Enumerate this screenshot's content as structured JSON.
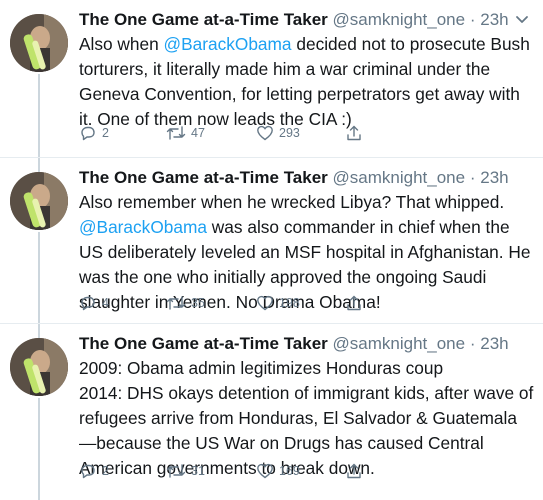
{
  "tweets": [
    {
      "author": "The One Game at-a-Time Taker",
      "handle": "@samknight_one",
      "dot": "·",
      "time": "23h",
      "text_before": "Also when ",
      "mention": "@BarackObama",
      "text_after": " decided not to prosecute Bush torturers, it literally made him a war criminal under the Geneva Convention, for letting perpetrators get away with it. One of them now leads the CIA :)",
      "replies": "2",
      "retweets": "47",
      "likes": "293"
    },
    {
      "author": "The One Game at-a-Time Taker",
      "handle": "@samknight_one",
      "dot": "·",
      "time": "23h",
      "text_before": "Also remember when he wrecked Libya? That whipped.\n",
      "mention": "@BarackObama",
      "text_after": " was also commander in chief when the US deliberately leveled an MSF hospital in Afghanistan. He was the one who initially approved the ongoing Saudi slaughter in Yemen. No Drama Obama!",
      "replies": "4",
      "retweets": "35",
      "likes": "198"
    },
    {
      "author": "The One Game at-a-Time Taker",
      "handle": "@samknight_one",
      "dot": "·",
      "time": "23h",
      "text_before": "2009: Obama admin legitimizes Honduras coup\n2014: DHS okays detention of immigrant kids, after wave of refugees arrive from Honduras, El Salvador & Guatemala—because the US War on Drugs has caused Central American governments to break down.",
      "mention": "",
      "text_after": "",
      "replies": "2",
      "retweets": "31",
      "likes": "169"
    }
  ],
  "icons": {
    "reply": "reply-icon",
    "retweet": "retweet-icon",
    "like": "heart-icon",
    "share": "share-icon",
    "caret": "chevron-down-icon"
  },
  "colors": {
    "mention": "#1da1f2",
    "muted": "#657786",
    "text": "#14171a",
    "thread_line": "#ccd6dd",
    "divider": "#e6ecf0"
  }
}
